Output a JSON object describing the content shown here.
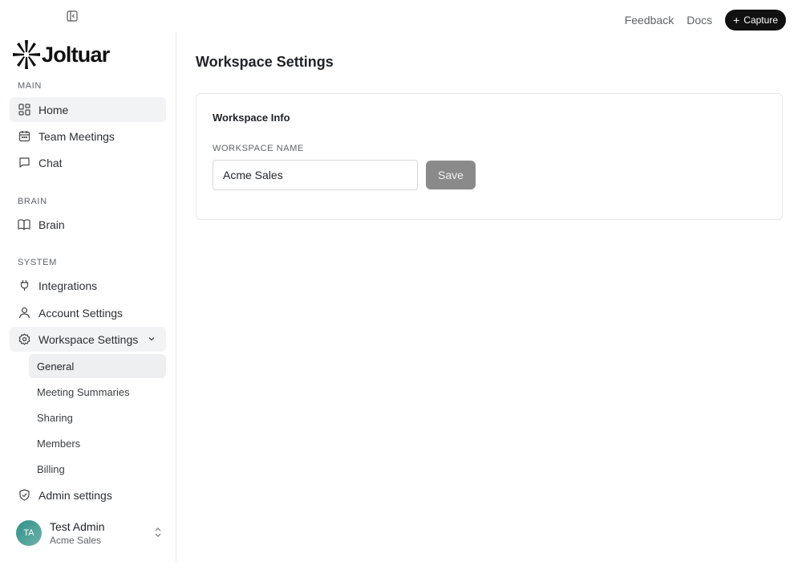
{
  "header": {
    "feedback_label": "Feedback",
    "docs_label": "Docs",
    "capture_label": "Capture"
  },
  "brand": {
    "name": "Joltuar"
  },
  "sidebar": {
    "sections": [
      {
        "label": "MAIN"
      },
      {
        "label": "BRAIN"
      },
      {
        "label": "SYSTEM"
      }
    ],
    "items": [
      {
        "label": "Home",
        "icon": "grid-icon"
      },
      {
        "label": "Team Meetings",
        "icon": "calendar-icon"
      },
      {
        "label": "Chat",
        "icon": "chat-icon"
      },
      {
        "label": "Brain",
        "icon": "book-icon"
      },
      {
        "label": "Integrations",
        "icon": "plug-icon"
      },
      {
        "label": "Account Settings",
        "icon": "user-icon"
      },
      {
        "label": "Workspace Settings",
        "icon": "gear-icon"
      },
      {
        "label": "Admin settings",
        "icon": "shield-icon"
      }
    ],
    "workspace_sub": [
      {
        "label": "General"
      },
      {
        "label": "Meeting Summaries"
      },
      {
        "label": "Sharing"
      },
      {
        "label": "Members"
      },
      {
        "label": "Billing"
      }
    ]
  },
  "user": {
    "initials": "TA",
    "name": "Test Admin",
    "workspace": "Acme Sales"
  },
  "main": {
    "title": "Workspace Settings",
    "card_title": "Workspace Info",
    "field_label": "WORKSPACE NAME",
    "field_value": "Acme Sales",
    "save_label": "Save"
  },
  "colors": {
    "capture_bg": "#111111",
    "save_bg": "#8a8a8a",
    "active_bg": "#f2f3f5"
  }
}
